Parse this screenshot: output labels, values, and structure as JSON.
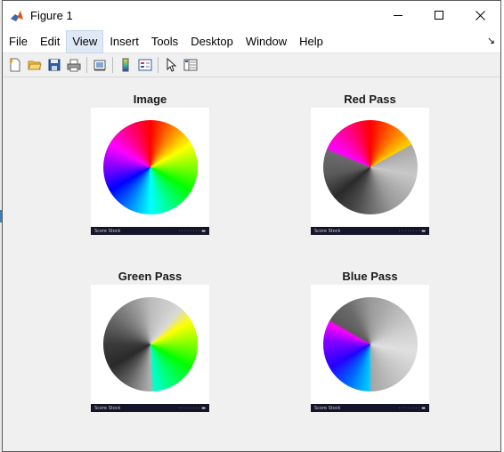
{
  "window": {
    "title": "Figure 1",
    "icon": "matlab-logo-icon",
    "controls": [
      "minimize-icon",
      "maximize-icon",
      "close-icon"
    ]
  },
  "menu": {
    "items": [
      {
        "label": "File"
      },
      {
        "label": "Edit"
      },
      {
        "label": "View",
        "active": true
      },
      {
        "label": "Insert"
      },
      {
        "label": "Tools"
      },
      {
        "label": "Desktop"
      },
      {
        "label": "Window"
      },
      {
        "label": "Help"
      }
    ],
    "corner_icon": "dock-arrow-icon"
  },
  "toolbar": {
    "buttons": [
      "new-figure-icon",
      "open-file-icon",
      "save-icon",
      "print-icon",
      "link-plot-icon",
      "insert-colorbar-icon",
      "insert-legend-icon",
      "edit-plot-arrow-icon",
      "property-inspector-icon"
    ]
  },
  "plots": {
    "image": {
      "title": "Image",
      "strip_left": "Score Stock",
      "strip_right": "· · · · · · · ·  ▬"
    },
    "red": {
      "title": "Red Pass",
      "strip_left": "Score Stock",
      "strip_right": "· · · · · · · ·  ▬"
    },
    "green": {
      "title": "Green Pass",
      "strip_left": "Score Stock",
      "strip_right": "· · · · · · · ·  ▬"
    },
    "blue": {
      "title": "Blue Pass",
      "strip_left": "Score Stock",
      "strip_right": "· · · · · · · ·  ▬"
    }
  },
  "colors": {
    "window_bg": "#f0f0f0",
    "menu_active": "#dfe9f5",
    "strip_bg": "#15152a"
  }
}
